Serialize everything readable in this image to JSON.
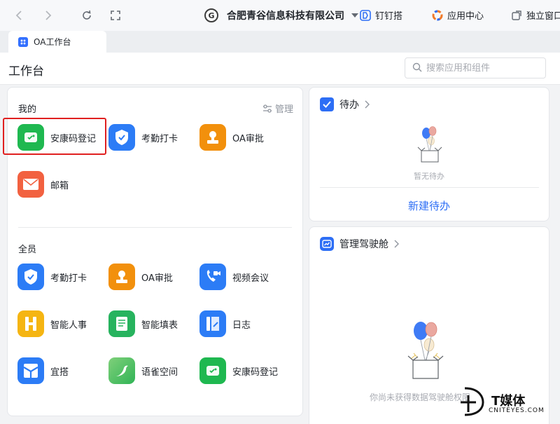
{
  "topbar": {
    "org_name": "合肥青谷信息科技有限公司",
    "org_logo": "G",
    "tools": [
      {
        "label": "钉钉搭",
        "icon": "dingda-icon"
      },
      {
        "label": "应用中心",
        "icon": "app-center-icon"
      },
      {
        "label": "独立窗口",
        "icon": "window-icon"
      }
    ]
  },
  "tab": {
    "label": "OA工作台"
  },
  "header": {
    "title": "工作台",
    "search_placeholder": "搜索应用和组件"
  },
  "mine": {
    "title": "我的",
    "manage_label": "管理",
    "apps": [
      {
        "label": "安康码登记",
        "icon": "health-code-icon",
        "color": "#1fb850"
      },
      {
        "label": "考勤打卡",
        "icon": "attendance-icon",
        "color": "#2c7cf6"
      },
      {
        "label": "OA审批",
        "icon": "approval-stamp-icon",
        "color": "#f2900c"
      },
      {
        "label": "邮箱",
        "icon": "mail-icon",
        "color": "#f26140"
      }
    ]
  },
  "all": {
    "title": "全员",
    "apps": [
      {
        "label": "考勤打卡",
        "icon": "attendance-icon",
        "color": "#2c7cf6"
      },
      {
        "label": "OA审批",
        "icon": "approval-stamp-icon",
        "color": "#f2900c"
      },
      {
        "label": "视频会议",
        "icon": "video-call-icon",
        "color": "#2c7cf6"
      },
      {
        "label": "智能人事",
        "icon": "hr-icon",
        "color": "#f5b512"
      },
      {
        "label": "智能填表",
        "icon": "form-icon",
        "color": "#27b35e"
      },
      {
        "label": "日志",
        "icon": "log-icon",
        "color": "#2c7cf6"
      },
      {
        "label": "宜搭",
        "icon": "yida-icon",
        "color": "#2c7cf6"
      },
      {
        "label": "语雀空间",
        "icon": "yuque-icon",
        "color": "#3fbf58"
      },
      {
        "label": "安康码登记",
        "icon": "health-code-icon",
        "color": "#1fb850"
      }
    ]
  },
  "todo": {
    "title": "待办",
    "empty_text": "暂无待办",
    "new_label": "新建待办"
  },
  "dashboard": {
    "title": "管理驾驶舱",
    "empty_text": "你尚未获得数据驾驶舱权限"
  },
  "watermark": {
    "text": "T媒体",
    "sub": "CNITEYES.COM"
  }
}
